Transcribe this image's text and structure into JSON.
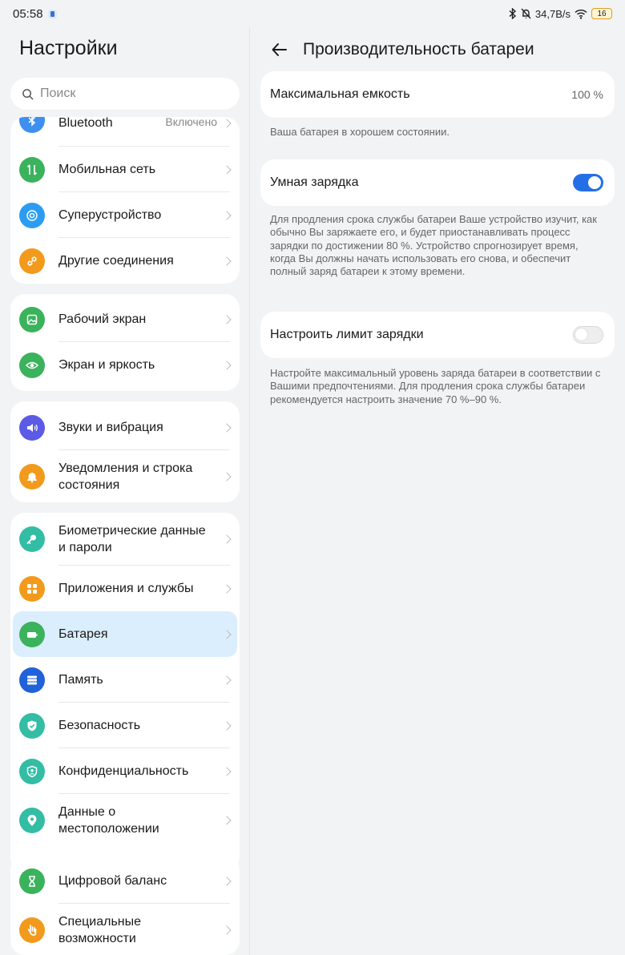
{
  "status": {
    "time": "05:58",
    "net_speed": "34,7B/s",
    "battery_level": "16"
  },
  "left": {
    "title": "Настройки",
    "search_placeholder": "Поиск",
    "groups": [
      {
        "items": [
          {
            "label": "Bluetooth",
            "value": "Включено",
            "icon": "bluetooth-icon",
            "color": "#3d8ff0"
          },
          {
            "label": "Мобильная сеть",
            "icon": "mobile-network-icon",
            "color": "#3bb25c"
          },
          {
            "label": "Суперустройство",
            "icon": "superdevice-icon",
            "color": "#2b9cf2"
          },
          {
            "label": "Другие соединения",
            "icon": "link-icon",
            "color": "#f29a1c"
          }
        ]
      },
      {
        "items": [
          {
            "label": "Рабочий экран",
            "icon": "home-screen-icon",
            "color": "#3bb25c"
          },
          {
            "label": "Экран и яркость",
            "icon": "eye-icon",
            "color": "#3bb25c"
          }
        ]
      },
      {
        "items": [
          {
            "label": "Звуки и вибрация",
            "icon": "sound-icon",
            "color": "#5b5be6"
          },
          {
            "label": "Уведомления и строка состояния",
            "icon": "bell-icon",
            "color": "#f29a1c"
          }
        ]
      },
      {
        "items": [
          {
            "label": "Биометрические данные и пароли",
            "icon": "key-icon",
            "color": "#33bda5"
          },
          {
            "label": "Приложения и службы",
            "icon": "apps-icon",
            "color": "#f29a1c"
          },
          {
            "label": "Батарея",
            "icon": "battery-icon",
            "color": "#3bb25c"
          },
          {
            "label": "Память",
            "icon": "storage-icon",
            "color": "#2161d9"
          },
          {
            "label": "Безопасность",
            "icon": "shield-icon",
            "color": "#33bda5"
          },
          {
            "label": "Конфиденциальность",
            "icon": "privacy-icon",
            "color": "#33bda5"
          },
          {
            "label": "Данные о местоположении",
            "icon": "location-icon",
            "color": "#33bda5"
          }
        ]
      },
      {
        "items": [
          {
            "label": "Цифровой баланс",
            "icon": "hourglass-icon",
            "color": "#3bb25c"
          },
          {
            "label": "Специальные возможности",
            "icon": "accessibility-icon",
            "color": "#f29a1c"
          }
        ]
      }
    ]
  },
  "right": {
    "title": "Производительность батареи",
    "max_capacity": {
      "label": "Максимальная емкость",
      "value": "100 %"
    },
    "capacity_hint": "Ваша батарея в хорошем состоянии.",
    "smart_charging": {
      "label": "Умная зарядка",
      "enabled": true
    },
    "smart_hint": "Для продления срока службы батареи Ваше устройство изучит, как обычно Вы заряжаете его, и будет приостанавливать процесс зарядки по достижении 80 %. Устройство спрогнозирует время, когда Вы должны начать использовать его снова, и обеспечит полный заряд батареи к этому времени.",
    "charge_limit": {
      "label": "Настроить лимит зарядки",
      "enabled": false
    },
    "limit_hint": "Настройте максимальный уровень заряда батареи в соответствии с Вашими предпочтениями. Для продления срока службы батареи рекомендуется настроить значение 70 %–90 %."
  }
}
